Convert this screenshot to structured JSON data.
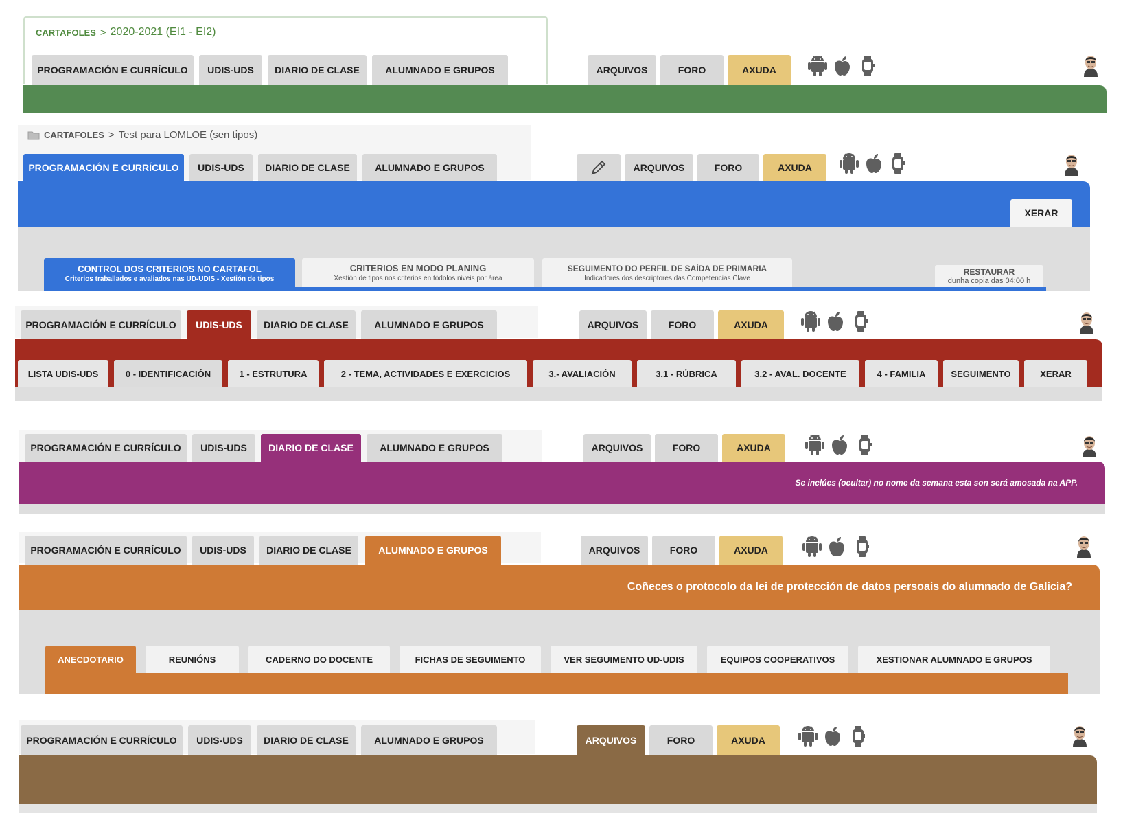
{
  "main_tabs": [
    "PROGRAMACIÓN E CURRÍCULO",
    "UDIS-UDS",
    "DIARIO DE CLASE",
    "ALUMNADO E GRUPOS"
  ],
  "right_tabs": [
    "ARQUIVOS",
    "FORO",
    "AXUDA"
  ],
  "colors": {
    "green": "#548a52",
    "blue": "#3473d8",
    "red": "#a32b1f",
    "purple": "#96307a",
    "orange": "#cf7a35",
    "brown": "#8a6a45",
    "axuda": "#e7c77a"
  },
  "icons": [
    "android-icon",
    "apple-icon",
    "watch-icon",
    "avatar",
    "pencil-icon",
    "folder-icon"
  ],
  "panel1": {
    "crumb_root": "CARTAFOLES",
    "crumb_sep": ">",
    "crumb_leaf": "2020-2021 (EI1 - EI2)"
  },
  "panel2": {
    "crumb_root": "CARTAFOLES",
    "crumb_sep": ">",
    "crumb_leaf": "Test para LOMLOE (sen tipos)",
    "xerar": "XERAR",
    "sub1_title": "CONTROL DOS CRITERIOS NO CARTAFOL",
    "sub1_desc": "Criterios traballados e avaliados nas UD-UDIS - Xestión de tipos",
    "sub2_title": "CRITERIOS EN MODO PLANING",
    "sub2_desc": "Xestión de tipos nos criterios en tódolos niveis por área",
    "sub3_title": "SEGUIMENTO DO PERFIL DE SAÍDA DE PRIMARIA",
    "sub3_desc": "Indicadores dos descriptores das Competencias Clave",
    "restore_title": "RESTAURAR",
    "restore_desc": "dunha copia das 04:00 h"
  },
  "panel3": {
    "subtabs": [
      "LISTA UDIS-UDS",
      "0 - IDENTIFICACIÓN",
      "1 - ESTRUTURA",
      "2 - TEMA, ACTIVIDADES E EXERCICIOS",
      "3.- AVALIACIÓN",
      "3.1 - RÚBRICA",
      "3.2 - AVAL. DOCENTE",
      "4 - FAMILIA",
      "SEGUIMENTO",
      "XERAR"
    ]
  },
  "panel4": {
    "note": "Se inclúes (ocultar) no nome da semana esta son será amosada na APP."
  },
  "panel5": {
    "question": "Coñeces o protocolo da lei de protección de datos persoais do alumnado de Galicia?",
    "subtabs": [
      "ANECDOTARIO",
      "REUNIÓNS",
      "CADERNO DO DOCENTE",
      "FICHAS DE SEGUIMENTO",
      "VER SEGUIMENTO UD-UDIS",
      "EQUIPOS COOPERATIVOS",
      "XESTIONAR ALUMNADO E GRUPOS"
    ]
  }
}
